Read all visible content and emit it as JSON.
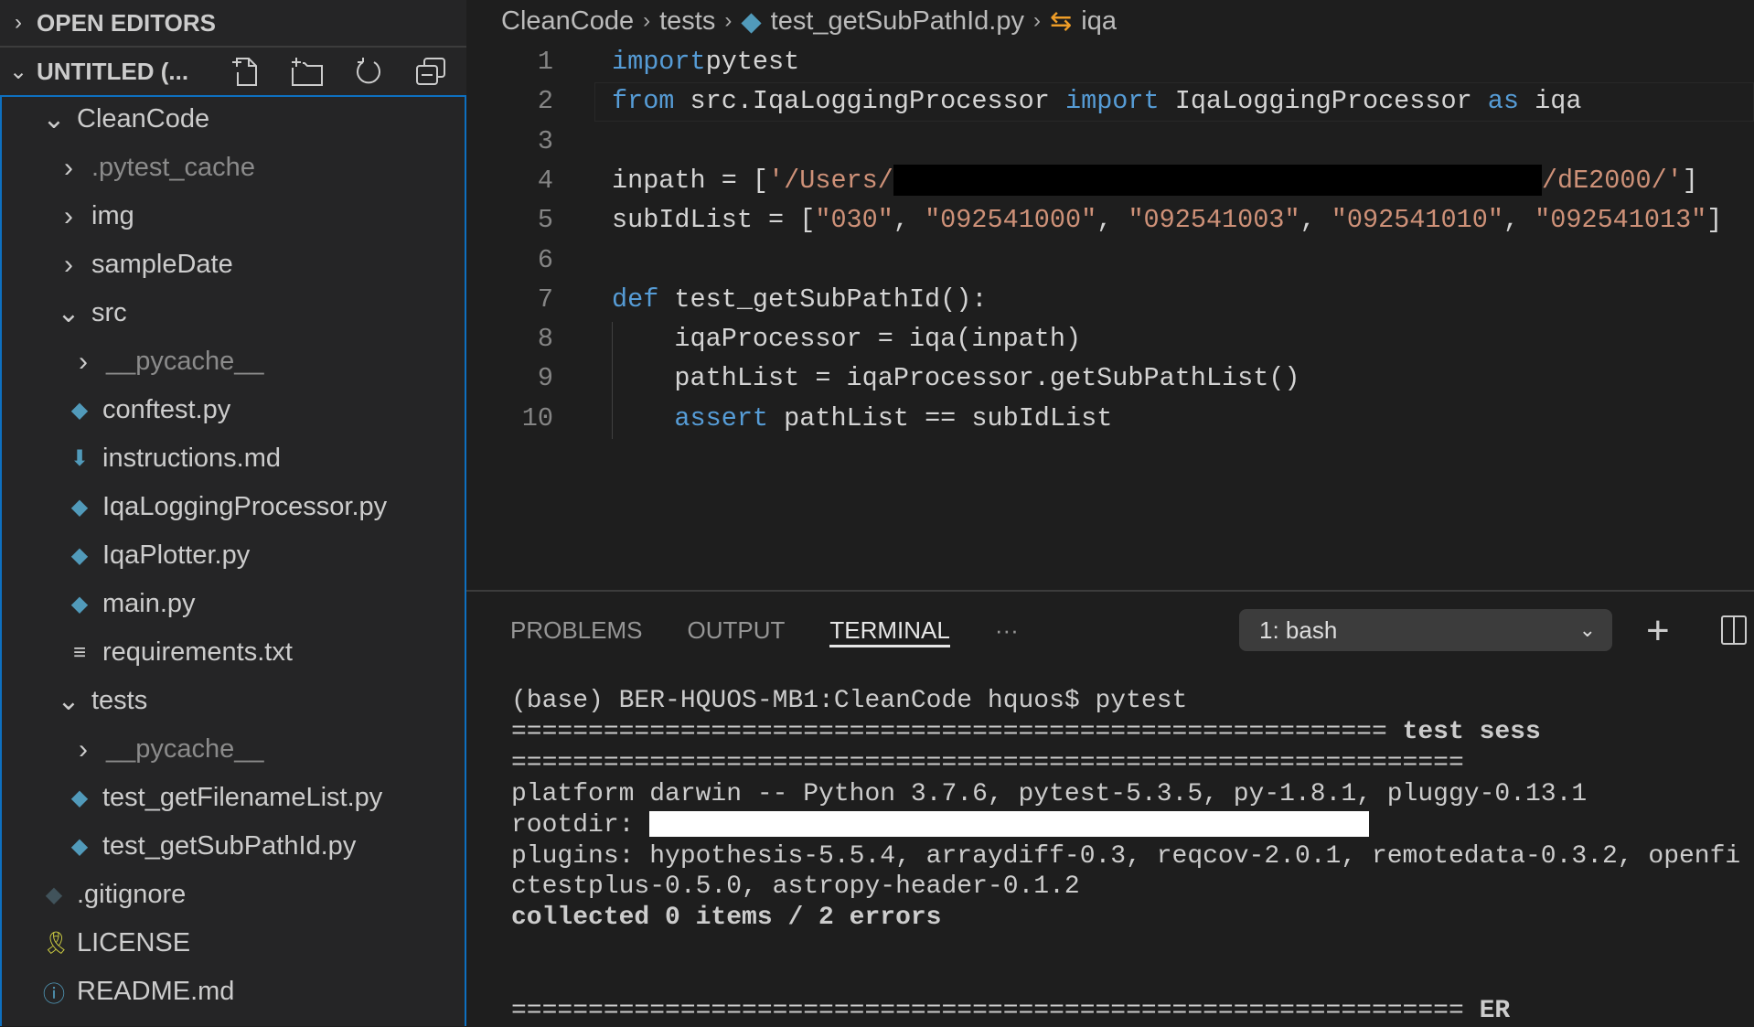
{
  "sidebar": {
    "open_editors": "OPEN EDITORS",
    "workspace": "UNTITLED (...",
    "actions": [
      "new-file",
      "new-folder",
      "refresh",
      "collapse-all"
    ],
    "tree": [
      {
        "label": "CleanCode",
        "type": "folder",
        "open": true,
        "level": 0
      },
      {
        "label": ".pytest_cache",
        "type": "folder",
        "open": false,
        "level": 1,
        "dim": true
      },
      {
        "label": "img",
        "type": "folder",
        "open": false,
        "level": 1
      },
      {
        "label": "sampleDate",
        "type": "folder",
        "open": false,
        "level": 1
      },
      {
        "label": "src",
        "type": "folder",
        "open": true,
        "level": 1
      },
      {
        "label": "__pycache__",
        "type": "folder",
        "open": false,
        "level": 2,
        "dim": true
      },
      {
        "label": "conftest.py",
        "type": "python",
        "level": 2
      },
      {
        "label": "instructions.md",
        "type": "markdown-download",
        "level": 2
      },
      {
        "label": "IqaLoggingProcessor.py",
        "type": "python",
        "level": 2
      },
      {
        "label": "IqaPlotter.py",
        "type": "python",
        "level": 2
      },
      {
        "label": "main.py",
        "type": "python",
        "level": 2
      },
      {
        "label": "requirements.txt",
        "type": "text",
        "level": 2
      },
      {
        "label": "tests",
        "type": "folder",
        "open": true,
        "level": 1
      },
      {
        "label": "__pycache__",
        "type": "folder",
        "open": false,
        "level": 2,
        "dim": true
      },
      {
        "label": "test_getFilenameList.py",
        "type": "python",
        "level": 2
      },
      {
        "label": "test_getSubPathId.py",
        "type": "python",
        "level": 2
      },
      {
        "label": ".gitignore",
        "type": "git",
        "level": 1
      },
      {
        "label": "LICENSE",
        "type": "license",
        "level": 1
      },
      {
        "label": "README.md",
        "type": "info",
        "level": 1
      }
    ]
  },
  "breadcrumb": [
    "CleanCode",
    "tests",
    "test_getSubPathId.py",
    "iqa"
  ],
  "editor": {
    "lines": [
      {
        "n": "1",
        "t": [
          [
            "kw",
            "import"
          ],
          [
            "",
            "pytest"
          ]
        ]
      },
      {
        "n": "2",
        "t": [
          [
            "kw",
            "from"
          ],
          [
            "",
            " src.IqaLoggingProcessor "
          ],
          [
            "kw",
            "import"
          ],
          [
            "",
            " IqaLoggingProcessor "
          ],
          [
            "kw",
            "as"
          ],
          [
            "",
            " iqa"
          ]
        ]
      },
      {
        "n": "3",
        "t": []
      },
      {
        "n": "4",
        "t": [
          [
            "",
            "inpath = ["
          ],
          [
            "st",
            "'/Users/"
          ],
          [
            "redact",
            ""
          ],
          [
            "st",
            "/dE2000/'"
          ],
          [
            "",
            "]"
          ]
        ]
      },
      {
        "n": "5",
        "t": [
          [
            "",
            "subIdList = ["
          ],
          [
            "st",
            "\"030\""
          ],
          [
            "",
            ", "
          ],
          [
            "st",
            "\"092541000\""
          ],
          [
            "",
            ", "
          ],
          [
            "st",
            "\"092541003\""
          ],
          [
            "",
            ", "
          ],
          [
            "st",
            "\"092541010\""
          ],
          [
            "",
            ", "
          ],
          [
            "st",
            "\"092541013\""
          ],
          [
            "",
            "]"
          ]
        ]
      },
      {
        "n": "6",
        "t": []
      },
      {
        "n": "7",
        "t": [
          [
            "kw",
            "def"
          ],
          [
            "",
            " test_getSubPathId():"
          ]
        ]
      },
      {
        "n": "8",
        "t": [
          [
            "",
            "    iqaProcessor = iqa(inpath)"
          ]
        ]
      },
      {
        "n": "9",
        "t": [
          [
            "",
            "    pathList = iqaProcessor.getSubPathList()"
          ]
        ]
      },
      {
        "n": "10",
        "t": [
          [
            "",
            "    "
          ],
          [
            "kw",
            "assert"
          ],
          [
            "",
            " pathList == subIdList"
          ]
        ]
      }
    ]
  },
  "panel": {
    "tabs": [
      "PROBLEMS",
      "OUTPUT",
      "TERMINAL",
      "···"
    ],
    "active_tab": "TERMINAL",
    "terminal_select": "1: bash",
    "terminal": [
      {
        "text": "(base) BER-HQUOS-MB1:CleanCode hquos$ pytest"
      },
      {
        "text": "========================================================= ",
        "bold": "test sess"
      },
      {
        "text": "=============================================================="
      },
      {
        "text": "platform darwin -- Python 3.7.6, pytest-5.3.5, py-1.8.1, pluggy-0.13.1"
      },
      {
        "text": "rootdir: ",
        "redacted": true
      },
      {
        "text": "plugins: hypothesis-5.5.4, arraydiff-0.3, reqcov-2.0.1, remotedata-0.3.2, openfi"
      },
      {
        "text": "ctestplus-0.5.0, astropy-header-0.1.2"
      },
      {
        "text": "",
        "bold": "collected 0 items / 2 errors"
      },
      {
        "text": ""
      },
      {
        "text": ""
      },
      {
        "text": "============================================================== ",
        "bold": "ER"
      }
    ]
  },
  "colors": {
    "keyword": "#569cd6",
    "string": "#ce9178",
    "python_icon": "#519aba",
    "focus_border": "#0e70c0"
  }
}
